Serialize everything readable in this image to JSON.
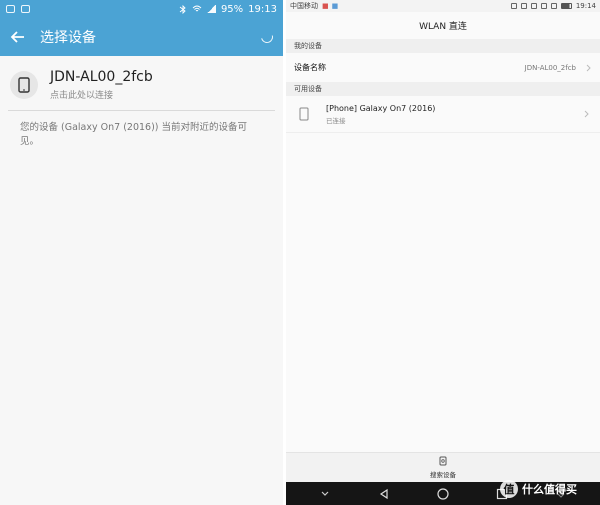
{
  "left": {
    "status": {
      "battery": "95%",
      "time": "19:13"
    },
    "title": "选择设备",
    "device": {
      "name": "JDN-AL00_2fcb",
      "subtitle": "点击此处以连接"
    },
    "description": "您的设备 (Galaxy On7 (2016)) 当前对附近的设备可见。"
  },
  "right": {
    "status": {
      "carrier": "中国移动",
      "time": "19:14"
    },
    "title": "WLAN 直连",
    "my_device_header": "我的设备",
    "device_name_label": "设备名称",
    "device_name_value": "JDN-AL00_2fcb",
    "available_header": "可用设备",
    "available_device": {
      "name": "[Phone] Galaxy On7 (2016)",
      "status": "已连接"
    },
    "search_label": "搜索设备"
  },
  "watermark": {
    "text": "什么值得买",
    "glyph": "值"
  },
  "colors": {
    "left_accent": "#4ba3d4",
    "nav_bar": "#151515"
  }
}
